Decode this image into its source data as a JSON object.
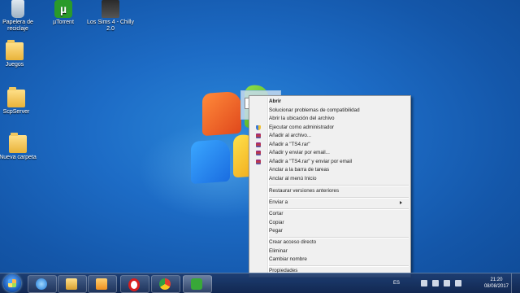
{
  "desktop": {
    "icons": [
      {
        "label": "Papelera de reciclaje",
        "icon": "recycle-bin-icon"
      },
      {
        "label": "µTorrent",
        "icon": "utorrent-icon"
      },
      {
        "label": "Los Sims 4 - Chilly 2.0",
        "icon": "sims-shortcut-icon"
      },
      {
        "label": "Juegos",
        "icon": "folder-icon"
      },
      {
        "label": "ScpServer",
        "icon": "folder-icon"
      },
      {
        "label": "Nueva carpeta",
        "icon": "folder-icon"
      }
    ]
  },
  "context_menu": {
    "items": [
      "Abrir",
      "Solucionar problemas de compatibilidad",
      "Abrir la ubicación del archivo",
      "Ejecutar como administrador",
      "Añadir al archivo...",
      "Añadir a \"TS4.rar\"",
      "Añadir y enviar por email...",
      "Añadir a \"TS4.rar\" y enviar por email",
      "Anclar a la barra de tareas",
      "Anclar al menú Inicio",
      "Restaurar versiones anteriores",
      "Enviar a",
      "Cortar",
      "Copiar",
      "Pegar",
      "Crear acceso directo",
      "Eliminar",
      "Cambiar nombre",
      "Propiedades"
    ]
  },
  "taskbar": {
    "pinned": [
      "internet-explorer-icon",
      "file-explorer-icon",
      "media-player-icon",
      "opera-icon",
      "chrome-icon",
      "utorrent-icon"
    ],
    "language": "ES",
    "time": "21:20",
    "date": "08/08/2017"
  },
  "colors": {
    "desktop": "#1d6cc6",
    "menu_bg": "#f0f0f0",
    "taskbar": "#1e3c6e"
  }
}
